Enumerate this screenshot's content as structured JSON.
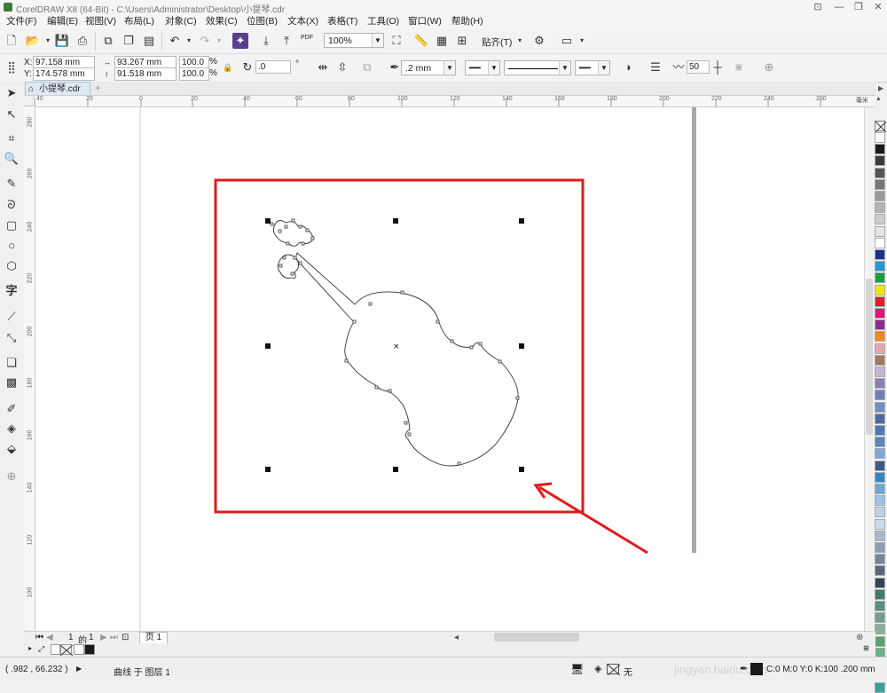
{
  "window": {
    "title": "CorelDRAW X8 (64-Bit) - C:\\Users\\Administrator\\Desktop\\小提琴.cdr",
    "controls": [
      "—",
      "❐",
      "✕"
    ]
  },
  "menu": [
    "文件(F)",
    "编辑(E)",
    "视图(V)",
    "布局(L)",
    "对象(C)",
    "效果(C)",
    "位图(B)",
    "文本(X)",
    "表格(T)",
    "工具(O)",
    "窗口(W)",
    "帮助(H)"
  ],
  "toolbar": {
    "zoom": "100%",
    "snap_label": "贴齐(T)",
    "pdf_label": "PDF"
  },
  "property_bar": {
    "x_label": "X:",
    "x_value": "97.158 mm",
    "y_label": "Y:",
    "y_value": "174.578 mm",
    "w_value": "93.267 mm",
    "h_value": "91.518 mm",
    "scale_w": "100.0",
    "scale_h": "100.0",
    "percent": "%",
    "angle": ".0",
    "degree": "°",
    "outline_width": ".2 mm",
    "smoothing": "50"
  },
  "document_tab": "小提琴.cdr",
  "ruler": {
    "h_ticks": [
      "40",
      "20",
      "0",
      "20",
      "40",
      "60",
      "80",
      "100",
      "120",
      "140",
      "160",
      "180",
      "200",
      "220",
      "240",
      "260"
    ],
    "unit": "毫米",
    "v_ticks": [
      "280",
      "260",
      "240",
      "220",
      "200",
      "180",
      "160",
      "140",
      "120",
      "100"
    ]
  },
  "page_nav": {
    "current": "1",
    "of": "的",
    "total": "1",
    "page_tab": "页 1"
  },
  "status": {
    "coords": "( .982 , 66.232 )",
    "object_info": "曲线 于 图层 1",
    "fill_none": "无",
    "color_info": "C:0 M:0 Y:0 K:100 .200 mm",
    "watermark": "jingyan.baidu.com"
  },
  "colors": {
    "highlight_box": "#e01b1b",
    "palette": [
      "#ffffff",
      "#1a1a1a",
      "#3a3a3a",
      "#555555",
      "#777777",
      "#999999",
      "#b3b3b3",
      "#cccccc",
      "#e6e6e6",
      "#ffffff",
      "#1b2f8c",
      "#1f9ad6",
      "#14a13a",
      "#f2e600",
      "#e31f26",
      "#e2137a",
      "#8e2a8c",
      "#f08a1d",
      "#e9a6b2",
      "#9e7c60",
      "#c4b3d9",
      "#8a80b8",
      "#6f7fb5",
      "#6e8fc8",
      "#4c6aa8",
      "#4d77b2",
      "#5a86bf",
      "#7fa6d6",
      "#3a5c8a",
      "#2e86c6",
      "#6aa8d8",
      "#9bc3e6",
      "#b7d3ec",
      "#c9dcee",
      "#a8b9cb",
      "#8aa0b6",
      "#748699",
      "#56697d",
      "#334455",
      "#3f7a6a",
      "#5d8f7f",
      "#6f9f8f",
      "#85b0a0",
      "#5aa06a",
      "#67b08a",
      "#7ec09a",
      "#4c9c8c",
      "#36a2a0"
    ]
  },
  "icons": {
    "new": "new-document-icon",
    "open": "open-icon",
    "save": "save-icon",
    "print": "print-icon",
    "undo": "undo-icon",
    "redo": "redo-icon",
    "settings": "gear-icon"
  }
}
